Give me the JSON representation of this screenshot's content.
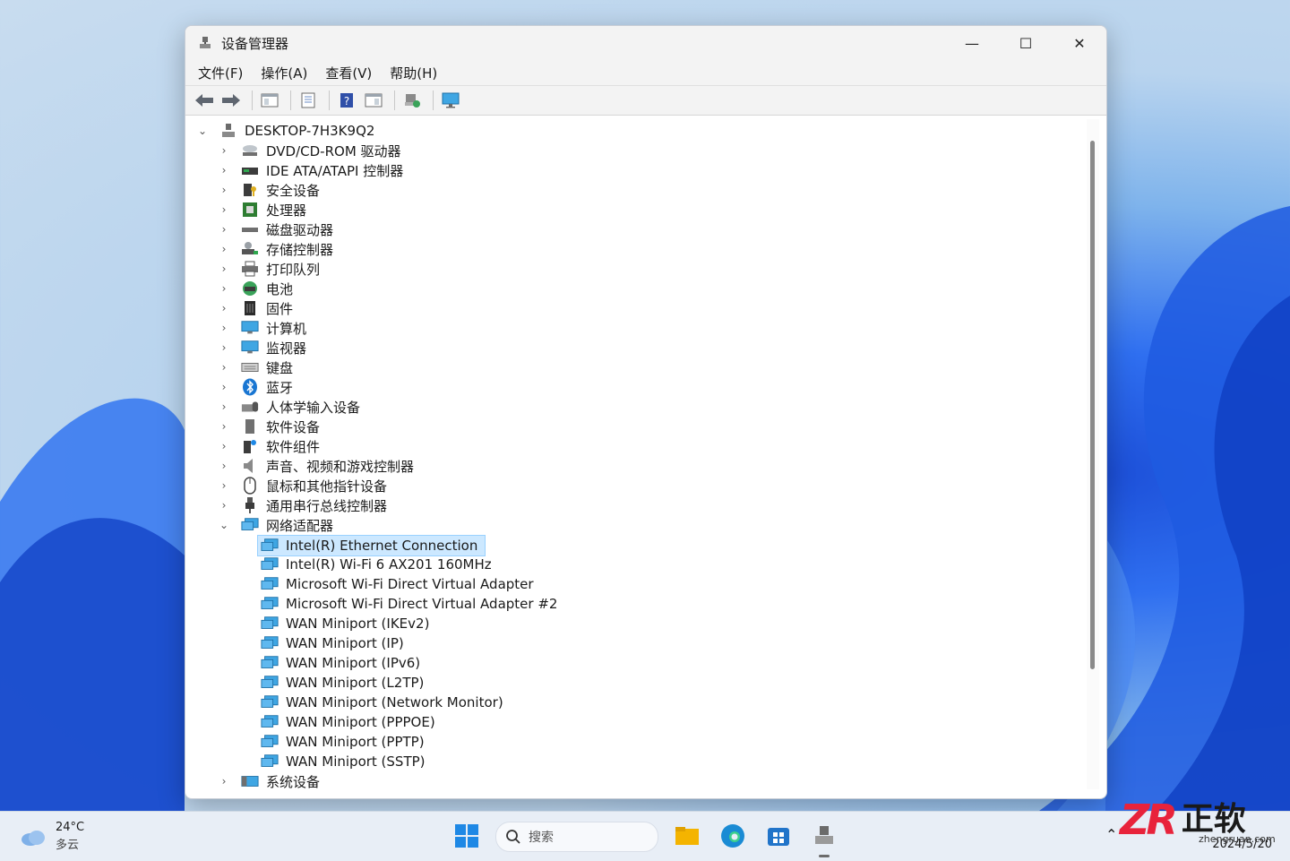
{
  "window": {
    "title": "设备管理器",
    "controls": {
      "minimize": "—",
      "maximize": "☐",
      "close": "✕"
    }
  },
  "menu": [
    "文件(F)",
    "操作(A)",
    "查看(V)",
    "帮助(H)"
  ],
  "toolbar": {
    "icons": [
      "back-arrow-icon",
      "forward-arrow-icon",
      "show-hide-console-tree-icon",
      "properties-icon",
      "help-icon",
      "action-pane-icon",
      "update-driver-icon",
      "scan-hardware-icon"
    ]
  },
  "tree": {
    "root": "DESKTOP-7H3K9Q2",
    "categories": [
      {
        "label": "DVD/CD-ROM 驱动器",
        "icon": "dvd-drive-icon"
      },
      {
        "label": "IDE ATA/ATAPI 控制器",
        "icon": "ide-controller-icon"
      },
      {
        "label": "安全设备",
        "icon": "security-device-icon"
      },
      {
        "label": "处理器",
        "icon": "processor-icon"
      },
      {
        "label": "磁盘驱动器",
        "icon": "disk-drive-icon"
      },
      {
        "label": "存储控制器",
        "icon": "storage-controller-icon"
      },
      {
        "label": "打印队列",
        "icon": "printer-icon"
      },
      {
        "label": "电池",
        "icon": "battery-icon"
      },
      {
        "label": "固件",
        "icon": "firmware-icon"
      },
      {
        "label": "计算机",
        "icon": "computer-icon"
      },
      {
        "label": "监视器",
        "icon": "monitor-icon"
      },
      {
        "label": "键盘",
        "icon": "keyboard-icon"
      },
      {
        "label": "蓝牙",
        "icon": "bluetooth-icon"
      },
      {
        "label": "人体学输入设备",
        "icon": "hid-icon"
      },
      {
        "label": "软件设备",
        "icon": "software-device-icon"
      },
      {
        "label": "软件组件",
        "icon": "software-component-icon"
      },
      {
        "label": "声音、视频和游戏控制器",
        "icon": "speaker-icon"
      },
      {
        "label": "鼠标和其他指针设备",
        "icon": "mouse-icon"
      },
      {
        "label": "通用串行总线控制器",
        "icon": "usb-icon"
      }
    ],
    "network": {
      "label": "网络适配器",
      "children": [
        "Intel(R) Ethernet Connection",
        "Intel(R) Wi-Fi 6 AX201 160MHz",
        "Microsoft Wi-Fi Direct Virtual Adapter",
        "Microsoft Wi-Fi Direct Virtual Adapter #2",
        "WAN Miniport (IKEv2)",
        "WAN Miniport (IP)",
        "WAN Miniport (IPv6)",
        "WAN Miniport (L2TP)",
        "WAN Miniport (Network Monitor)",
        "WAN Miniport (PPPOE)",
        "WAN Miniport (PPTP)",
        "WAN Miniport (SSTP)"
      ],
      "selected_index": 0
    },
    "last": {
      "label": "系统设备",
      "icon": "system-device-icon"
    }
  },
  "taskbar": {
    "weather": {
      "temp": "24°C",
      "desc": "多云"
    },
    "search_placeholder": "搜索",
    "date": "2024/5/20"
  },
  "watermark": {
    "logo": "ZR",
    "name": "正软",
    "url": "zhengruan.com"
  },
  "colors": {
    "selection": "#cce8ff",
    "selection_border": "#99d1ff",
    "accent": "#0067c0",
    "watermark_red": "#e8233b"
  }
}
